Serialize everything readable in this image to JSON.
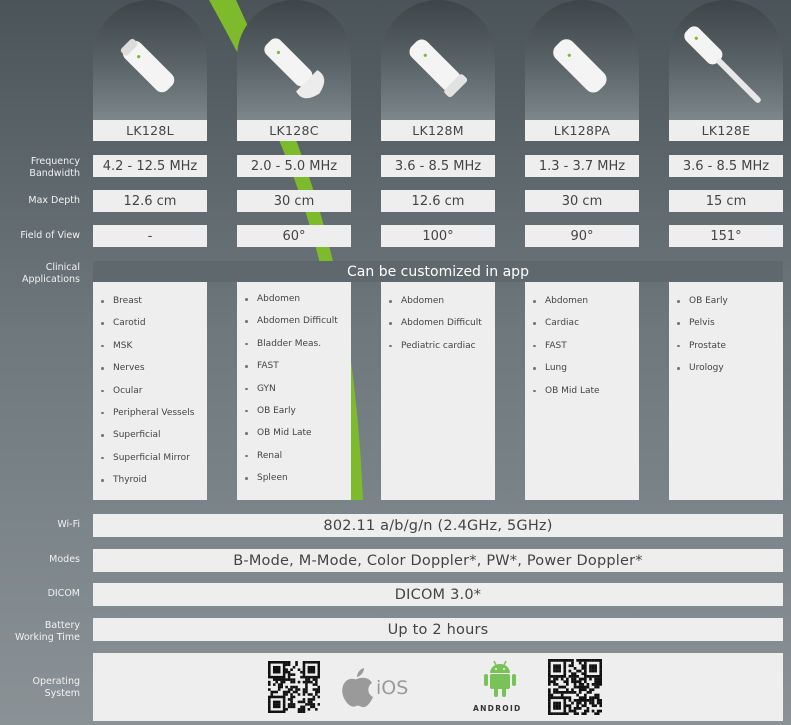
{
  "models": [
    "LK128L",
    "LK128C",
    "LK128M",
    "LK128PA",
    "LK128E"
  ],
  "labels": {
    "frequency_line1": "Frequency",
    "frequency_line2": "Bandwidth",
    "max_depth": "Max Depth",
    "field_of_view": "Field of View",
    "clinical_line1": "Clinical",
    "clinical_line2": "Applications",
    "wifi": "Wi-Fi",
    "modes": "Modes",
    "dicom": "DICOM",
    "battery_line1": "Battery",
    "battery_line2": "Working Time",
    "os_line1": "Operating",
    "os_line2": "System"
  },
  "frequency": [
    "4.2 - 12.5 MHz",
    "2.0 - 5.0 MHz",
    "3.6 - 8.5 MHz",
    "1.3 - 3.7 MHz",
    "3.6 - 8.5 MHz"
  ],
  "max_depth": [
    "12.6 cm",
    "30 cm",
    "12.6 cm",
    "30 cm",
    "15 cm"
  ],
  "field_of_view": [
    "-",
    "60°",
    "100°",
    "90°",
    "151°"
  ],
  "clinical_banner": "Can be customized in app",
  "applications": [
    [
      "Breast",
      "Carotid",
      "MSK",
      "Nerves",
      "Ocular",
      "Peripheral Vessels",
      "Superficial",
      "Superficial Mirror",
      "Thyroid"
    ],
    [
      "Abdomen",
      "Abdomen Difficult",
      "Bladder Meas.",
      "FAST",
      "GYN",
      "OB Early",
      "OB Mid Late",
      "Renal",
      "Spleen"
    ],
    [
      "Abdomen",
      "Abdomen Difficult",
      "Pediatric cardiac"
    ],
    [
      "Abdomen",
      "Cardiac",
      "FAST",
      "Lung",
      "OB Mid Late"
    ],
    [
      "OB Early",
      "Pelvis",
      "Prostate",
      "Urology"
    ]
  ],
  "wifi": "802.11 a/b/g/n (2.4GHz, 5GHz)",
  "modes": "B-Mode, M-Mode, Color Doppler*, PW*, Power Doppler*",
  "dicom": "DICOM 3.0*",
  "battery": "Up to 2 hours",
  "os": {
    "ios_label": "iOS",
    "android_label": "ANDROID"
  },
  "colors": {
    "accent_green": "#7dbb2d",
    "cell_bg": "#eeeeee",
    "banner_bg": "#5f686d",
    "android_green": "#78c257"
  },
  "icons": [
    "probe-image",
    "qr-code-icon",
    "apple-logo-icon",
    "android-robot-icon"
  ]
}
